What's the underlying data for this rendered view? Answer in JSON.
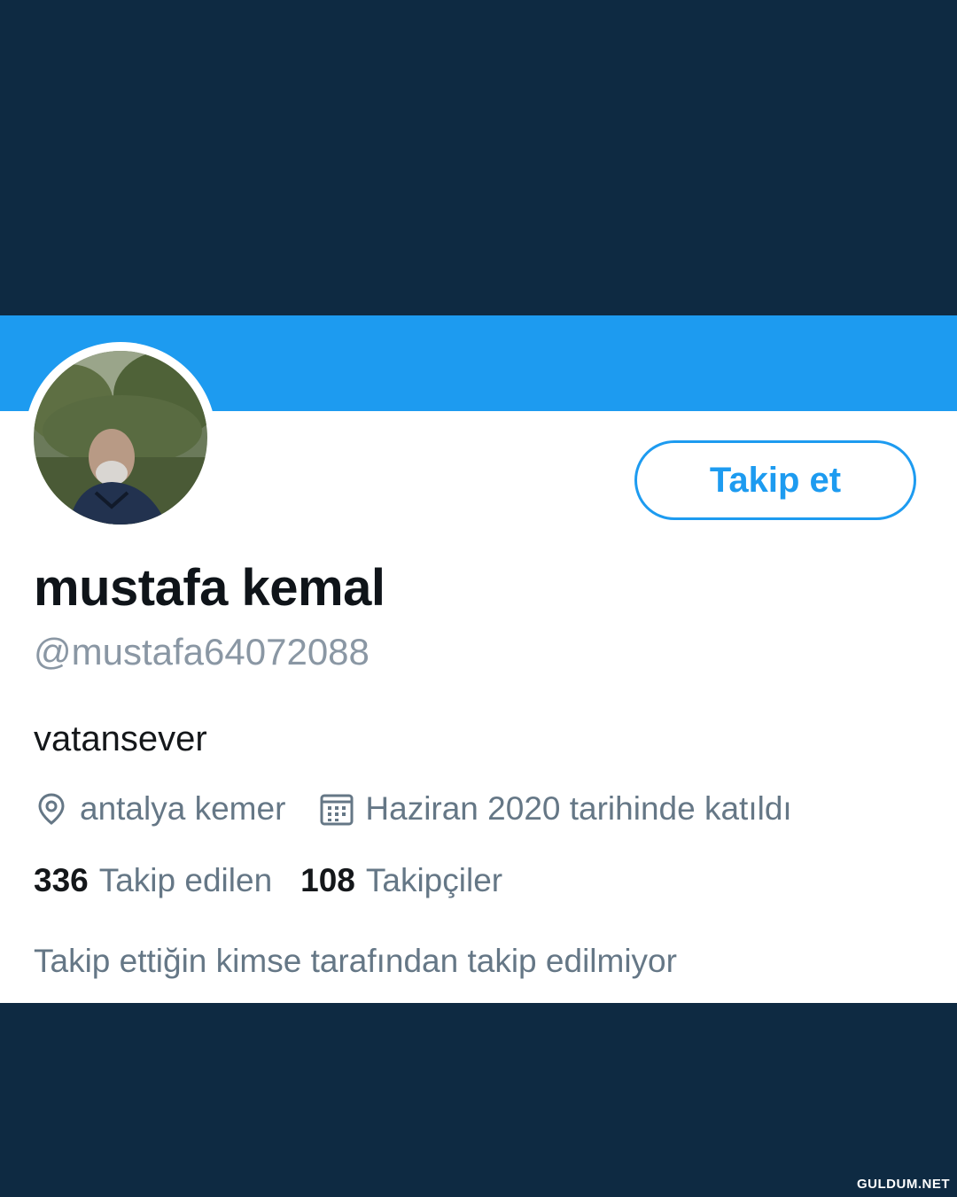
{
  "profile": {
    "display_name": "mustafa kemal",
    "handle": "@mustafa64072088",
    "bio": "vatansever",
    "location": "antalya kemer",
    "joined": "Haziran 2020 tarihinde katıldı",
    "follow_button_label": "Takip et"
  },
  "stats": {
    "following_count": "336",
    "following_label": "Takip edilen",
    "followers_count": "108",
    "followers_label": "Takipçiler"
  },
  "followed_by_note": "Takip ettiğin kimse tarafından takip edilmiyor",
  "icons": {
    "location": "location-pin-icon",
    "calendar": "calendar-icon"
  },
  "colors": {
    "accent": "#1d9bf0",
    "banner": "#1d9bf0",
    "background": "#0e2a42",
    "secondary_text": "#657786"
  },
  "watermark": "GULDUM.NET"
}
